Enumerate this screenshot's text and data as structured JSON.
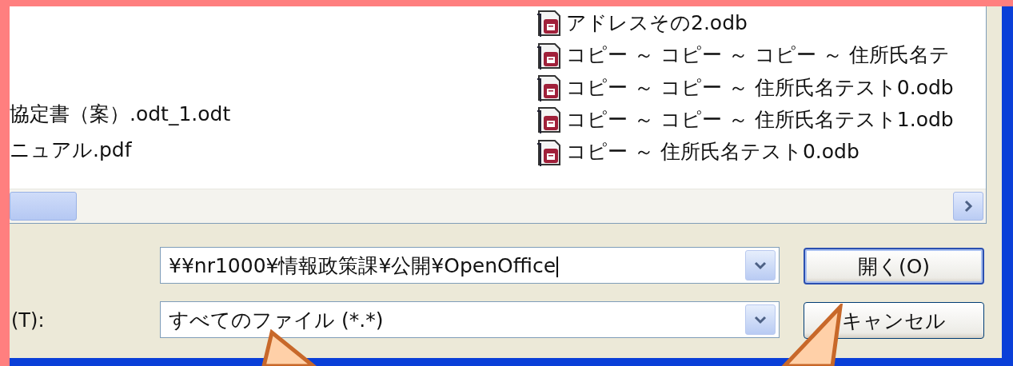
{
  "file_list": {
    "left_column": [
      {
        "name": "協定書（案）.odt_1.odt"
      },
      {
        "name": "ニュアル.pdf"
      }
    ],
    "right_column": [
      {
        "name": "アドレスその2.odb",
        "kind": "database"
      },
      {
        "name": "コピー ～ コピー ～ コピー ～ 住所氏名テ",
        "kind": "database"
      },
      {
        "name": "コピー ～ コピー ～ 住所氏名テスト0.odb",
        "kind": "database"
      },
      {
        "name": "コピー ～ コピー ～ 住所氏名テスト1.odb",
        "kind": "database"
      },
      {
        "name": "コピー ～ 住所氏名テスト0.odb",
        "kind": "database"
      }
    ]
  },
  "file_name": {
    "value": "¥¥nr1000¥情報政策課¥公開¥OpenOffice"
  },
  "file_type": {
    "label": "(T):",
    "value": "すべてのファイル (*.*)"
  },
  "buttons": [
    {
      "label": "開く(O)",
      "kind": "default"
    },
    {
      "label": "キャンセル",
      "kind": "normal"
    }
  ]
}
